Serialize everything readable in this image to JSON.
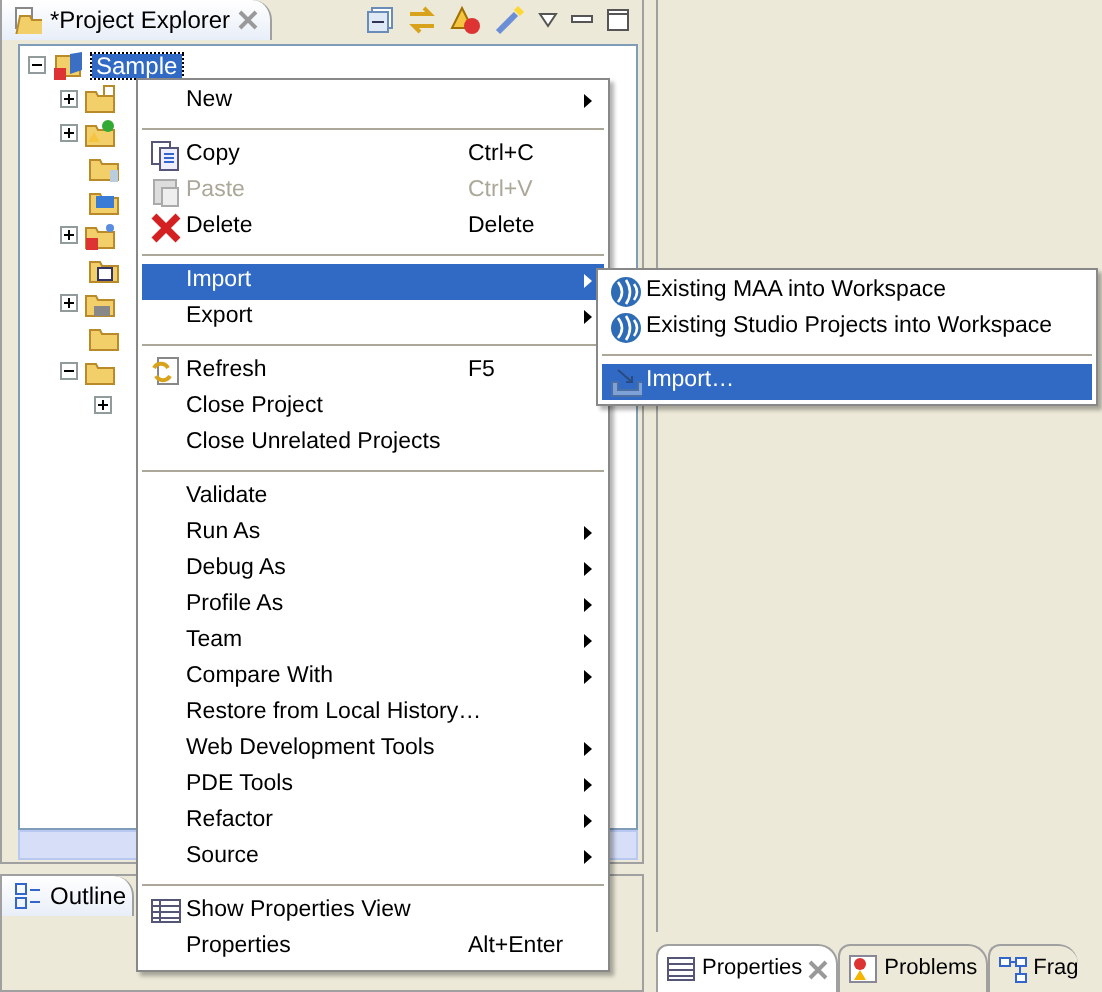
{
  "explorer": {
    "tab": {
      "label": "*Project Explorer"
    },
    "tree": {
      "label": "Sample",
      "selected": true,
      "expanded": true,
      "children": [
        {
          "kind": "expandable",
          "expanded": false
        },
        {
          "kind": "expandable",
          "expanded": false
        },
        {
          "kind": "leaf"
        },
        {
          "kind": "leaf"
        },
        {
          "kind": "expandable",
          "expanded": false
        },
        {
          "kind": "leaf"
        },
        {
          "kind": "expandable",
          "expanded": false
        },
        {
          "kind": "leaf"
        },
        {
          "kind": "expandable",
          "expanded": true,
          "children": [
            {
              "kind": "expandable",
              "expanded": false
            }
          ]
        }
      ]
    }
  },
  "outline": {
    "tab": {
      "label": "Outline"
    }
  },
  "bottom_tabs": [
    {
      "label": "Properties",
      "selected": true
    },
    {
      "label": "Problems",
      "selected": false
    },
    {
      "label": "Frag",
      "selected": false
    }
  ],
  "context_menu": [
    {
      "kind": "item",
      "label": "New",
      "submenu": true,
      "selected": false,
      "disabled": false
    },
    {
      "kind": "separator"
    },
    {
      "kind": "item",
      "label": "Copy",
      "shortcut": "Ctrl+C",
      "selected": false,
      "disabled": false
    },
    {
      "kind": "item",
      "label": "Paste",
      "shortcut": "Ctrl+V",
      "selected": false,
      "disabled": true
    },
    {
      "kind": "item",
      "label": "Delete",
      "shortcut": "Delete",
      "selected": false,
      "disabled": false
    },
    {
      "kind": "separator"
    },
    {
      "kind": "item",
      "label": "Import",
      "submenu": true,
      "selected": true,
      "disabled": false
    },
    {
      "kind": "item",
      "label": "Export",
      "submenu": true,
      "selected": false,
      "disabled": false
    },
    {
      "kind": "separator"
    },
    {
      "kind": "item",
      "label": "Refresh",
      "shortcut": "F5",
      "selected": false,
      "disabled": false
    },
    {
      "kind": "item",
      "label": "Close Project",
      "selected": false,
      "disabled": false
    },
    {
      "kind": "item",
      "label": "Close Unrelated Projects",
      "selected": false,
      "disabled": false
    },
    {
      "kind": "separator"
    },
    {
      "kind": "item",
      "label": "Validate",
      "selected": false,
      "disabled": false
    },
    {
      "kind": "item",
      "label": "Run As",
      "submenu": true,
      "selected": false,
      "disabled": false
    },
    {
      "kind": "item",
      "label": "Debug As",
      "submenu": true,
      "selected": false,
      "disabled": false
    },
    {
      "kind": "item",
      "label": "Profile As",
      "submenu": true,
      "selected": false,
      "disabled": false
    },
    {
      "kind": "item",
      "label": "Team",
      "submenu": true,
      "selected": false,
      "disabled": false
    },
    {
      "kind": "item",
      "label": "Compare With",
      "submenu": true,
      "selected": false,
      "disabled": false
    },
    {
      "kind": "item",
      "label": "Restore from Local History…",
      "selected": false,
      "disabled": false
    },
    {
      "kind": "item",
      "label": "Web Development Tools",
      "submenu": true,
      "selected": false,
      "disabled": false
    },
    {
      "kind": "item",
      "label": "PDE Tools",
      "submenu": true,
      "selected": false,
      "disabled": false
    },
    {
      "kind": "item",
      "label": "Refactor",
      "submenu": true,
      "selected": false,
      "disabled": false
    },
    {
      "kind": "item",
      "label": "Source",
      "submenu": true,
      "selected": false,
      "disabled": false
    },
    {
      "kind": "separator"
    },
    {
      "kind": "item",
      "label": "Show Properties View",
      "selected": false,
      "disabled": false
    },
    {
      "kind": "item",
      "label": "Properties",
      "shortcut": "Alt+Enter",
      "selected": false,
      "disabled": false
    }
  ],
  "import_submenu": [
    {
      "kind": "item",
      "label": "Existing MAA into Workspace",
      "selected": false
    },
    {
      "kind": "item",
      "label": "Existing Studio Projects into Workspace",
      "selected": false
    },
    {
      "kind": "separator"
    },
    {
      "kind": "item",
      "label": "Import…",
      "selected": true
    }
  ]
}
